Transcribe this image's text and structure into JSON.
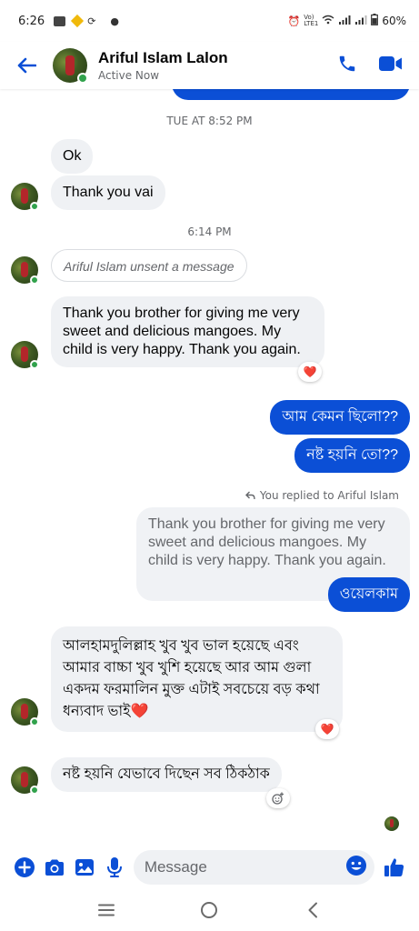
{
  "status_bar": {
    "time": "6:26",
    "battery": "60%",
    "left_icons": [
      "notification-icon",
      "binance-icon",
      "sync-icon",
      "dot-icon"
    ],
    "right_icons": [
      "alarm-icon",
      "volte-icon",
      "wifi-icon",
      "signal-icon",
      "signal-icon",
      "battery-icon"
    ]
  },
  "header": {
    "contact_name": "Ariful Islam Lalon",
    "status": "Active Now",
    "accent_color": "#0b4fd6"
  },
  "chat": {
    "separators": [
      "TUE AT 8:52 PM",
      "6:14 PM"
    ],
    "messages": [
      {
        "sender": "them",
        "text": "Ok"
      },
      {
        "sender": "them",
        "text": "Thank you vai"
      },
      {
        "sender": "them",
        "text": "Ariful Islam unsent a message",
        "kind": "unsent"
      },
      {
        "sender": "them",
        "text": "Thank you brother for giving me very sweet and delicious mangoes. My child is very happy. Thank you again.",
        "reaction": "❤️"
      },
      {
        "sender": "me",
        "text": "আম কেমন ছিলো??"
      },
      {
        "sender": "me",
        "text": "নষ্ট হয়নি তো??"
      },
      {
        "sender": "me",
        "text": "Thank you brother for giving me very sweet and delicious mangoes. My child is very happy. Thank you again.",
        "kind": "quoted"
      },
      {
        "sender": "me",
        "text": "ওয়েলকাম"
      },
      {
        "sender": "them",
        "text": "আলহামদুলিল্লাহ খুব খুব ভাল হয়েছে এবং আমার বাচ্চা খুব খুশি হয়েছে আর আম গুলা একদম ফরমালিন মুক্ত এটাই সবচেয়ে বড় কথা ধন্যবাদ ভাই❤️",
        "reaction": "❤️"
      },
      {
        "sender": "them",
        "text": "নষ্ট হয়নি যেভাবে দিছেন সব ঠিকঠাক",
        "reaction": "add-reaction"
      }
    ],
    "replied_note": "You replied to Ariful Islam"
  },
  "composer": {
    "placeholder": "Message"
  }
}
